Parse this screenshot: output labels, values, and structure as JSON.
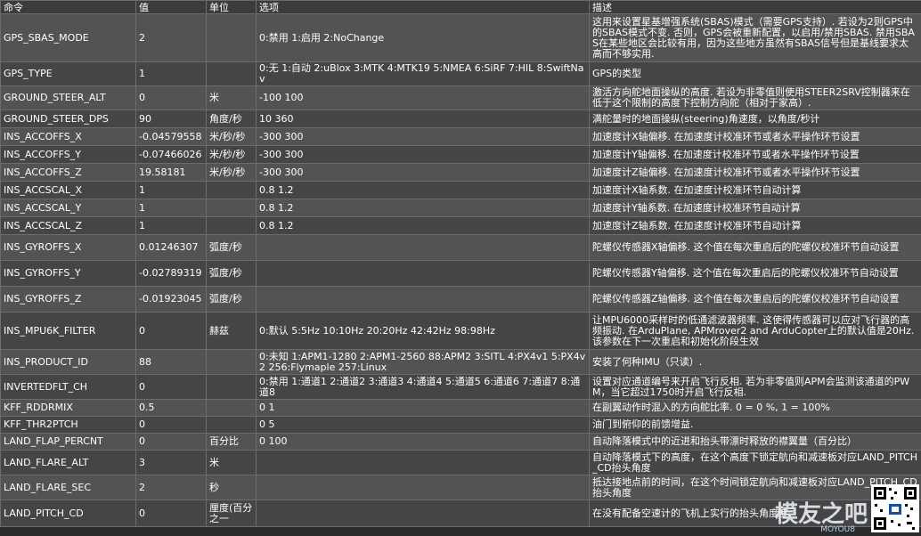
{
  "columns": [
    "命令",
    "值",
    "单位",
    "选项",
    "描述"
  ],
  "rows": [
    {
      "cmd": "GPS_SBAS_MODE",
      "val": "2",
      "unit": "",
      "opt": "0:禁用 1:启用 2:NoChange",
      "desc": "这用来设置星基增强系统(SBAS)模式（需要GPS支持）. 若设为2则GPS中的SBAS模式不变. 否则，GPS会被重新配置，以启用/禁用SBAS. 禁用SBAS在某些地区会比较有用，因为这些地方虽然有SBAS信号但是基线要求太高而不够实用."
    },
    {
      "cmd": "GPS_TYPE",
      "val": "1",
      "unit": "",
      "opt": "0:无 1:自动 2:uBlox 3:MTK 4:MTK19 5:NMEA 6:SiRF 7:HIL 8:SwiftNav",
      "desc": "GPS的类型"
    },
    {
      "cmd": "GROUND_STEER_ALT",
      "val": "0",
      "unit": "米",
      "opt": "-100 100",
      "desc": "激活方向舵地面操纵的高度. 若设为非零值则使用STEER2SRV控制器来在低于这个限制的高度下控制方向舵（相对于家高）."
    },
    {
      "cmd": "GROUND_STEER_DPS",
      "val": "90",
      "unit": "角度/秒",
      "opt": "10 360",
      "desc": "满舵量时的地面操纵(steering)角速度，以角度/秒计"
    },
    {
      "cmd": "INS_ACCOFFS_X",
      "val": "-0.04579558",
      "unit": "米/秒/秒",
      "opt": "-300 300",
      "desc": "加速度计X轴偏移. 在加速度计校准环节或者水平操作环节设置"
    },
    {
      "cmd": "INS_ACCOFFS_Y",
      "val": "-0.07466026",
      "unit": "米/秒/秒",
      "opt": "-300 300",
      "desc": "加速度计Y轴偏移. 在加速度计校准环节或者水平操作环节设置"
    },
    {
      "cmd": "INS_ACCOFFS_Z",
      "val": "19.58181",
      "unit": "米/秒/秒",
      "opt": "-300 300",
      "desc": "加速度计Z轴偏移. 在加速度计校准环节或者水平操作环节设置"
    },
    {
      "cmd": "INS_ACCSCAL_X",
      "val": "1",
      "unit": "",
      "opt": "0.8 1.2",
      "desc": "加速度计X轴系数. 在加速度计校准环节自动计算"
    },
    {
      "cmd": "INS_ACCSCAL_Y",
      "val": "1",
      "unit": "",
      "opt": "0.8 1.2",
      "desc": "加速度计Y轴系数. 在加速度计校准环节自动计算"
    },
    {
      "cmd": "INS_ACCSCAL_Z",
      "val": "1",
      "unit": "",
      "opt": "0.8 1.2",
      "desc": "加速度计Z轴系数. 在加速度计校准环节自动计算"
    },
    {
      "cmd": "INS_GYROFFS_X",
      "val": "0.01246307",
      "unit": "弧度/秒",
      "opt": "",
      "desc": "陀螺仪传感器X轴偏移. 这个值在每次重启后的陀螺仪校准环节自动设置"
    },
    {
      "cmd": "INS_GYROFFS_Y",
      "val": "-0.02789319",
      "unit": "弧度/秒",
      "opt": "",
      "desc": "陀螺仪传感器Y轴偏移. 这个值在每次重启后的陀螺仪校准环节自动设置"
    },
    {
      "cmd": "INS_GYROFFS_Z",
      "val": "-0.01923045",
      "unit": "弧度/秒",
      "opt": "",
      "desc": "陀螺仪传感器Z轴偏移. 这个值在每次重启后的陀螺仪校准环节自动设置"
    },
    {
      "cmd": "INS_MPU6K_FILTER",
      "val": "0",
      "unit": "赫兹",
      "opt": "0:默认 5:5Hz 10:10Hz 20:20Hz 42:42Hz 98:98Hz",
      "desc": "让MPU6000采样时的低通滤波器频率. 这使得传感器可以应对飞行器的高频振动. 在ArduPlane, APMrover2 and ArduCopter上的默认值是20Hz. 该参数在下一次重启和初始化阶段生效"
    },
    {
      "cmd": "INS_PRODUCT_ID",
      "val": "88",
      "unit": "",
      "opt": "0:未知 1:APM1-1280 2:APM1-2560 88:APM2 3:SITL 4:PX4v1 5:PX4v2 256:Flymaple 257:Linux",
      "desc": "安装了何种IMU（只读）."
    },
    {
      "cmd": "INVERTEDFLT_CH",
      "val": "0",
      "unit": "",
      "opt": "0:禁用 1:通道1 2:通道2 3:通道3 4:通道4 5:通道5 6:通道6 7:通道7 8:通道8",
      "desc": "设置对应通道编号来开启飞行反相. 若为非零值则APM会监测该通道的PWM，当它超过1750时开启飞行反相."
    },
    {
      "cmd": "KFF_RDDRMIX",
      "val": "0.5",
      "unit": "",
      "opt": "0 1",
      "desc": "在副翼动作时混入的方向舵比率. 0 = 0 %, 1 = 100%"
    },
    {
      "cmd": "KFF_THR2PTCH",
      "val": "0",
      "unit": "",
      "opt": "0 5",
      "desc": "油门到俯仰的前馈增益."
    },
    {
      "cmd": "LAND_FLAP_PERCNT",
      "val": "0",
      "unit": "百分比",
      "opt": "0 100",
      "desc": "自动降落模式中的近进和抬头带漂时释放的襟翼量（百分比）"
    },
    {
      "cmd": "LAND_FLARE_ALT",
      "val": "3",
      "unit": "米",
      "opt": "",
      "desc": "自动降落模式下的高度，在这个高度下锁定航向和减速板对应LAND_PITCH_CD抬头角度"
    },
    {
      "cmd": "LAND_FLARE_SEC",
      "val": "2",
      "unit": "秒",
      "opt": "",
      "desc": "抵达接地点前的时间，在这个时间锁定航向和减速板对应LAND_PITCH_CD抬头角度"
    },
    {
      "cmd": "LAND_PITCH_CD",
      "val": "0",
      "unit": "厘度(百分之一",
      "opt": "",
      "desc": "在没有配备空速计的飞机上实行的抬头角度度."
    }
  ],
  "watermark": {
    "text": "模友之吧",
    "sub": "MOYOU8"
  }
}
